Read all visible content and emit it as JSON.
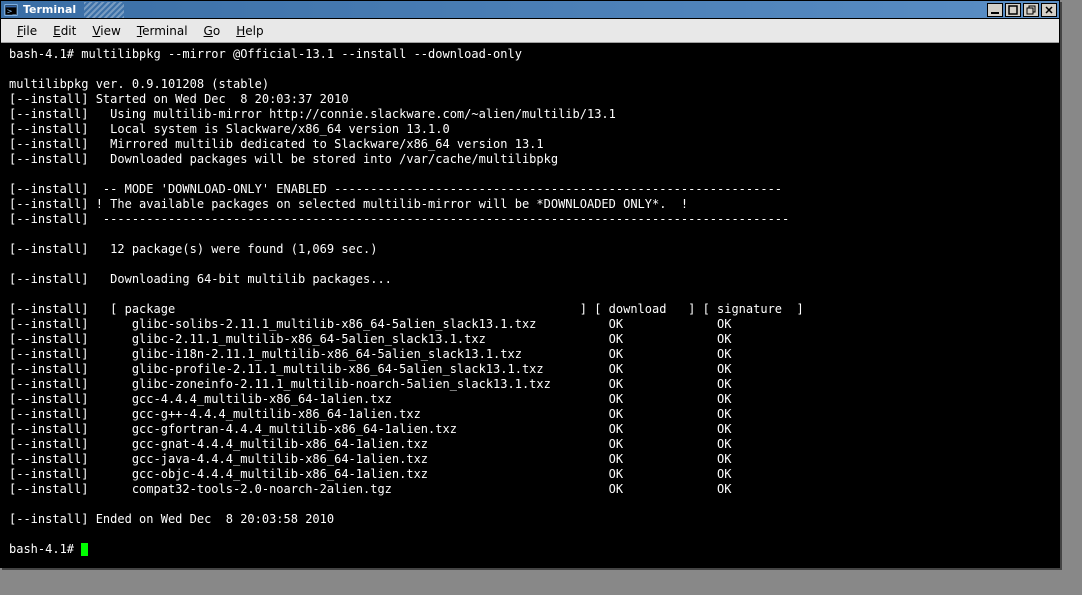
{
  "window": {
    "title": "Terminal"
  },
  "menu": {
    "file": "File",
    "edit": "Edit",
    "view": "View",
    "terminal": "Terminal",
    "go": "Go",
    "help": "Help"
  },
  "prompt": "bash-4.1# ",
  "command": "multilibpkg --mirror @Official-13.1 --install --download-only",
  "lines": {
    "l0": "multilibpkg ver. 0.9.101208 (stable)",
    "l1": "[--install] Started on Wed Dec  8 20:03:37 2010",
    "l2": "[--install]   Using multilib-mirror http://connie.slackware.com/~alien/multilib/13.1",
    "l3": "[--install]   Local system is Slackware/x86_64 version 13.1.0",
    "l4": "[--install]   Mirrored multilib dedicated to Slackware/x86_64 version 13.1",
    "l5": "[--install]   Downloaded packages will be stored into /var/cache/multilibpkg",
    "l6": "[--install]  -- MODE 'DOWNLOAD-ONLY' ENABLED --------------------------------------------------------------",
    "l7": "[--install] ! The available packages on selected multilib-mirror will be *DOWNLOADED ONLY*.  !",
    "l8": "[--install]  -----------------------------------------------------------------------------------------------",
    "l9": "[--install]   12 package(s) were found (1,069 sec.)",
    "l10": "[--install]   Downloading 64-bit multilib packages...",
    "l11": "[--install]   [ package                                                        ] [ download   ] [ signature  ]",
    "l12": "[--install]      glibc-solibs-2.11.1_multilib-x86_64-5alien_slack13.1.txz          OK             OK",
    "l13": "[--install]      glibc-2.11.1_multilib-x86_64-5alien_slack13.1.txz                 OK             OK",
    "l14": "[--install]      glibc-i18n-2.11.1_multilib-x86_64-5alien_slack13.1.txz            OK             OK",
    "l15": "[--install]      glibc-profile-2.11.1_multilib-x86_64-5alien_slack13.1.txz         OK             OK",
    "l16": "[--install]      glibc-zoneinfo-2.11.1_multilib-noarch-5alien_slack13.1.txz        OK             OK",
    "l17": "[--install]      gcc-4.4.4_multilib-x86_64-1alien.txz                              OK             OK",
    "l18": "[--install]      gcc-g++-4.4.4_multilib-x86_64-1alien.txz                          OK             OK",
    "l19": "[--install]      gcc-gfortran-4.4.4_multilib-x86_64-1alien.txz                     OK             OK",
    "l20": "[--install]      gcc-gnat-4.4.4_multilib-x86_64-1alien.txz                         OK             OK",
    "l21": "[--install]      gcc-java-4.4.4_multilib-x86_64-1alien.txz                         OK             OK",
    "l22": "[--install]      gcc-objc-4.4.4_multilib-x86_64-1alien.txz                         OK             OK",
    "l23": "[--install]      compat32-tools-2.0-noarch-2alien.tgz                              OK             OK",
    "l24": "[--install] Ended on Wed Dec  8 20:03:58 2010"
  },
  "chart_data": {
    "type": "table",
    "title": "Downloading 64-bit multilib packages",
    "columns": [
      "package",
      "download",
      "signature"
    ],
    "rows": [
      {
        "package": "glibc-solibs-2.11.1_multilib-x86_64-5alien_slack13.1.txz",
        "download": "OK",
        "signature": "OK"
      },
      {
        "package": "glibc-2.11.1_multilib-x86_64-5alien_slack13.1.txz",
        "download": "OK",
        "signature": "OK"
      },
      {
        "package": "glibc-i18n-2.11.1_multilib-x86_64-5alien_slack13.1.txz",
        "download": "OK",
        "signature": "OK"
      },
      {
        "package": "glibc-profile-2.11.1_multilib-x86_64-5alien_slack13.1.txz",
        "download": "OK",
        "signature": "OK"
      },
      {
        "package": "glibc-zoneinfo-2.11.1_multilib-noarch-5alien_slack13.1.txz",
        "download": "OK",
        "signature": "OK"
      },
      {
        "package": "gcc-4.4.4_multilib-x86_64-1alien.txz",
        "download": "OK",
        "signature": "OK"
      },
      {
        "package": "gcc-g++-4.4.4_multilib-x86_64-1alien.txz",
        "download": "OK",
        "signature": "OK"
      },
      {
        "package": "gcc-gfortran-4.4.4_multilib-x86_64-1alien.txz",
        "download": "OK",
        "signature": "OK"
      },
      {
        "package": "gcc-gnat-4.4.4_multilib-x86_64-1alien.txz",
        "download": "OK",
        "signature": "OK"
      },
      {
        "package": "gcc-java-4.4.4_multilib-x86_64-1alien.txz",
        "download": "OK",
        "signature": "OK"
      },
      {
        "package": "gcc-objc-4.4.4_multilib-x86_64-1alien.txz",
        "download": "OK",
        "signature": "OK"
      },
      {
        "package": "compat32-tools-2.0-noarch-2alien.tgz",
        "download": "OK",
        "signature": "OK"
      }
    ]
  }
}
